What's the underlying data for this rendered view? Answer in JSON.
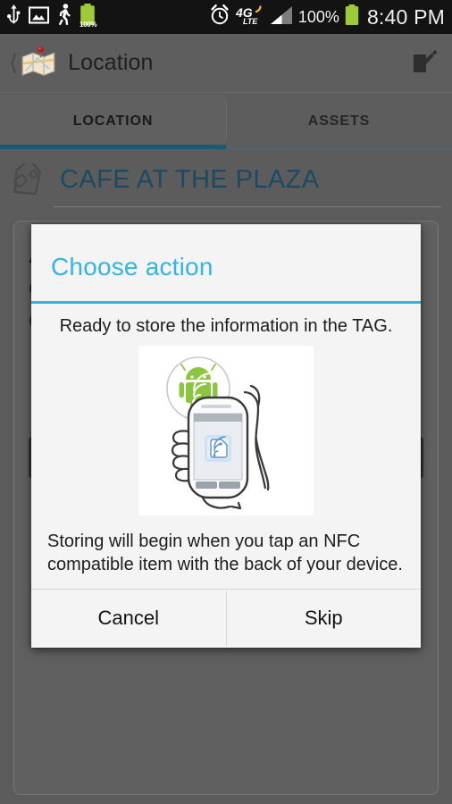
{
  "status_bar": {
    "icons_left": [
      "usb-icon",
      "gallery-image-icon",
      "pedometer-walking-icon",
      "battery-charge-icon"
    ],
    "battery_badge": "100%",
    "icons_right": [
      "alarm-clock-icon",
      "4g-lte-icon",
      "signal-bars-icon"
    ],
    "battery_percent": "100%",
    "clock": "8:40 PM",
    "background": "#131313"
  },
  "action_bar": {
    "back_icon": "back-chevron-icon",
    "app_icon": "map-pin-location-icon",
    "title": "Location",
    "edit_icon": "edit-compose-icon",
    "background": "#5e5e5e"
  },
  "tabs": {
    "items": [
      {
        "label": "LOCATION",
        "selected": true
      },
      {
        "label": "ASSETS",
        "selected": false
      }
    ],
    "indicator_color": "#1a5a74"
  },
  "page_header": {
    "icon": "price-tag-icon",
    "title": "CAFE AT THE PLAZA",
    "title_color": "#1c4a63"
  },
  "background_card": {
    "lines": [
      "A",
      "C",
      "C"
    ],
    "buttons": [
      "",
      ""
    ]
  },
  "dialog": {
    "title": "Choose action",
    "title_color": "#34b3e4",
    "message_top": "Ready to store the information in the TAG.",
    "illustration": "nfc-tap-phone-android-illustration",
    "message_bottom": "Storing will begin when you tap an NFC compatible item with the back of your device.",
    "buttons": [
      {
        "label": "Cancel"
      },
      {
        "label": "Skip"
      }
    ]
  }
}
